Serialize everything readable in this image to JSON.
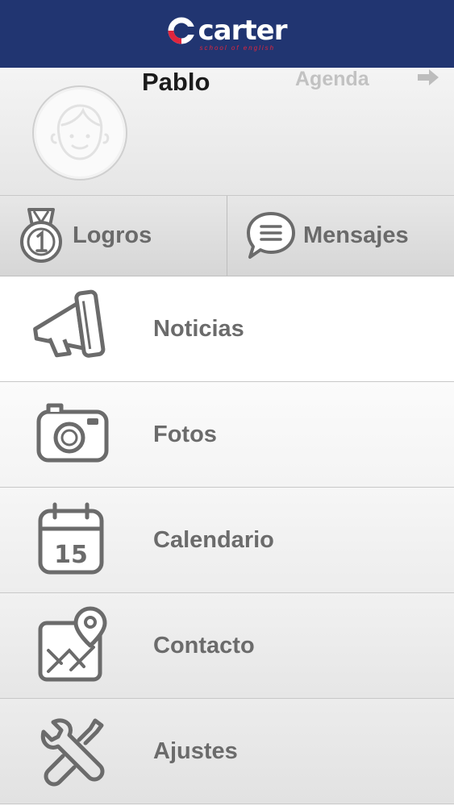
{
  "header": {
    "brand": "carter",
    "tagline": "school of english",
    "accent_color": "#e0253d",
    "background_color": "#213571"
  },
  "profile": {
    "name": "Pablo",
    "agenda_label": "Agenda",
    "avatar_icon": "child-face-icon",
    "arrow_icon": "arrow-right-icon"
  },
  "tabs": [
    {
      "label": "Logros",
      "icon": "medal-icon"
    },
    {
      "label": "Mensajes",
      "icon": "chat-bubble-icon"
    }
  ],
  "menu": [
    {
      "label": "Noticias",
      "icon": "megaphone-icon"
    },
    {
      "label": "Fotos",
      "icon": "camera-icon"
    },
    {
      "label": "Calendario",
      "icon": "calendar-icon",
      "day": "15"
    },
    {
      "label": "Contacto",
      "icon": "map-pin-icon"
    },
    {
      "label": "Ajustes",
      "icon": "tools-icon"
    }
  ]
}
